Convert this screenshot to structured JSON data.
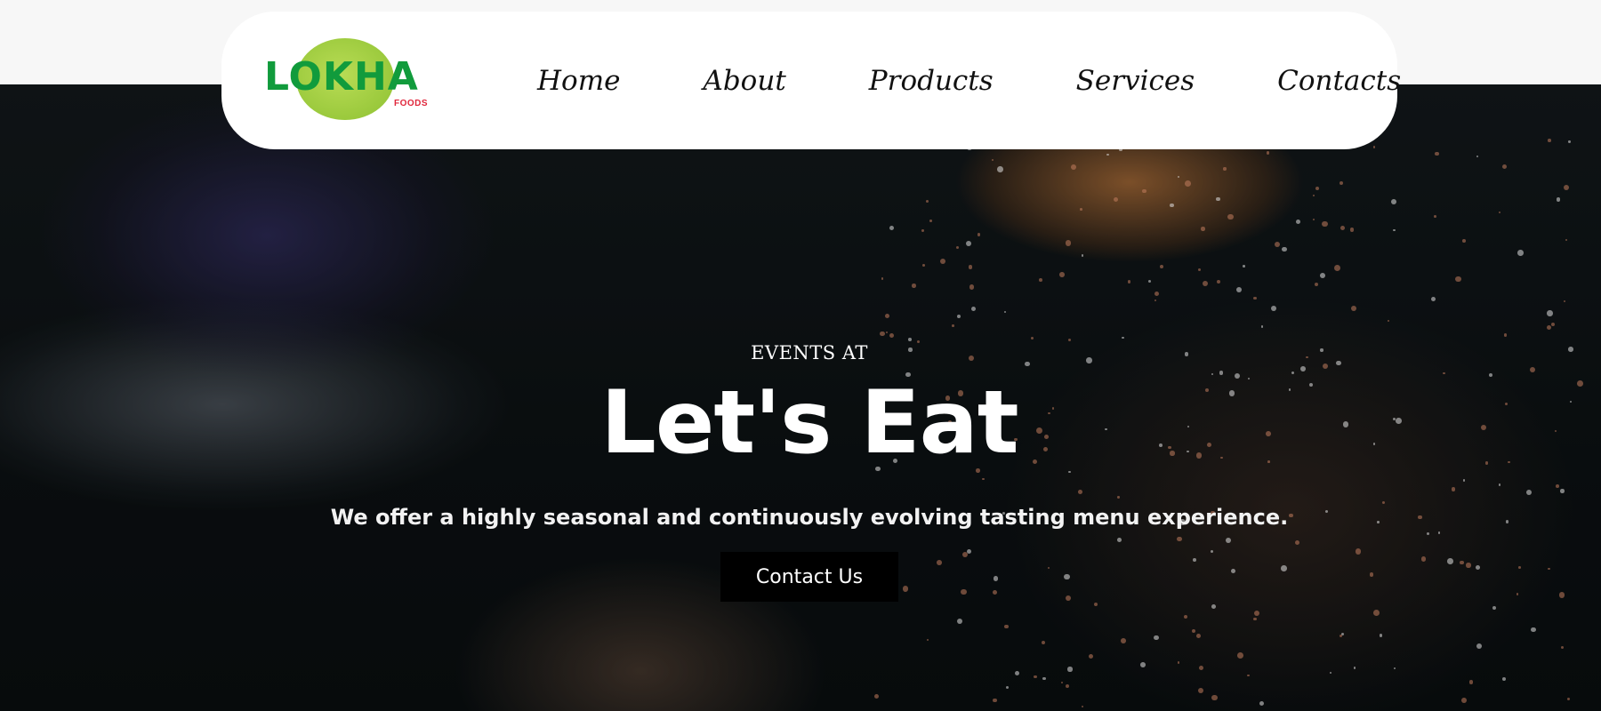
{
  "brand": {
    "logo_text": "LOKHA",
    "logo_subtext": "FOODS",
    "logo_text_color": "#119b3c",
    "logo_blob_color": "#9ac93c",
    "logo_subtext_color": "#e0263b"
  },
  "nav": {
    "items": [
      {
        "label": "Home"
      },
      {
        "label": "About"
      },
      {
        "label": "Products"
      },
      {
        "label": "Services"
      },
      {
        "label": "Contacts"
      }
    ]
  },
  "hero": {
    "eyebrow": "EVENTS AT",
    "headline": "Let's Eat",
    "subtitle": "We offer a highly seasonal and continuously evolving tasting menu experience.",
    "cta_label": "Contact Us",
    "background_image": "dark-food-photo-croissant-lavender"
  },
  "colors": {
    "navbar_bg": "#ffffff",
    "hero_text": "#ffffff",
    "cta_bg": "#000000",
    "page_bg": "#f7f7f7"
  }
}
